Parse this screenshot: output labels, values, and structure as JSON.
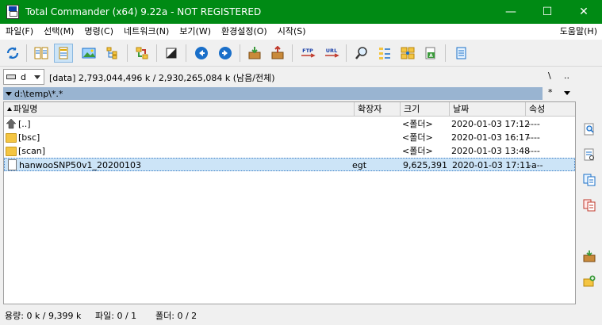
{
  "window": {
    "title": "Total Commander (x64) 9.22a - NOT REGISTERED",
    "accent": "#008a14"
  },
  "window_controls": {
    "minimize": "—",
    "maximize": "☐",
    "close": "✕"
  },
  "menu": {
    "items": [
      "파일(F)",
      "선택(M)",
      "명령(C)",
      "네트워크(N)",
      "보기(W)",
      "환경설정(O)",
      "시작(S)"
    ],
    "help": "도움말(H)"
  },
  "toolbar": {
    "buttons": [
      "refresh-icon",
      "brief-view-icon",
      "full-view-icon",
      "thumbnails-icon",
      "tree-icon",
      "sync-dirs-icon",
      "invert-selection-icon",
      "back-icon",
      "forward-icon",
      "pack-icon",
      "unpack-icon",
      "ftp-icon",
      "url-icon",
      "search-icon",
      "multi-rename-icon",
      "compare-icon",
      "edit-icon",
      "notepad-icon"
    ],
    "ftp_label": "FTP",
    "url_label": "URL"
  },
  "drive": {
    "letter": "d",
    "info": "[data]  2,793,044,496 k / 2,930,265,084 k (남음/전체)",
    "root": "\\",
    "up": ".."
  },
  "path": {
    "text": "d:\\temp\\*.*",
    "filter_star": "*"
  },
  "columns": {
    "name": "파일명",
    "ext": "확장자",
    "size": "크기",
    "date": "날짜",
    "attr": "속성"
  },
  "rows": [
    {
      "type": "updir",
      "name": "[..]",
      "ext": "",
      "size": "<폴더>",
      "date": "2020-01-03 17:12",
      "attr": "----"
    },
    {
      "type": "folder",
      "name": "[bsc]",
      "ext": "",
      "size": "<폴더>",
      "date": "2020-01-03 16:17",
      "attr": "----"
    },
    {
      "type": "folder",
      "name": "[scan]",
      "ext": "",
      "size": "<폴더>",
      "date": "2020-01-03 13:48",
      "attr": "----"
    },
    {
      "type": "file",
      "name": "hanwooSNP50v1_20200103",
      "ext": "egt",
      "size": "9,625,391",
      "date": "2020-01-03 17:11",
      "attr": "-a--"
    }
  ],
  "right_strip": [
    "find-icon",
    "view-icon",
    "copy-icon",
    "move-icon",
    "pack-icon",
    "new-folder-icon"
  ],
  "status": {
    "space": "용량: 0 k / 9,399 k",
    "files": "파일: 0 / 1",
    "folders": "폴더: 0 / 2"
  }
}
